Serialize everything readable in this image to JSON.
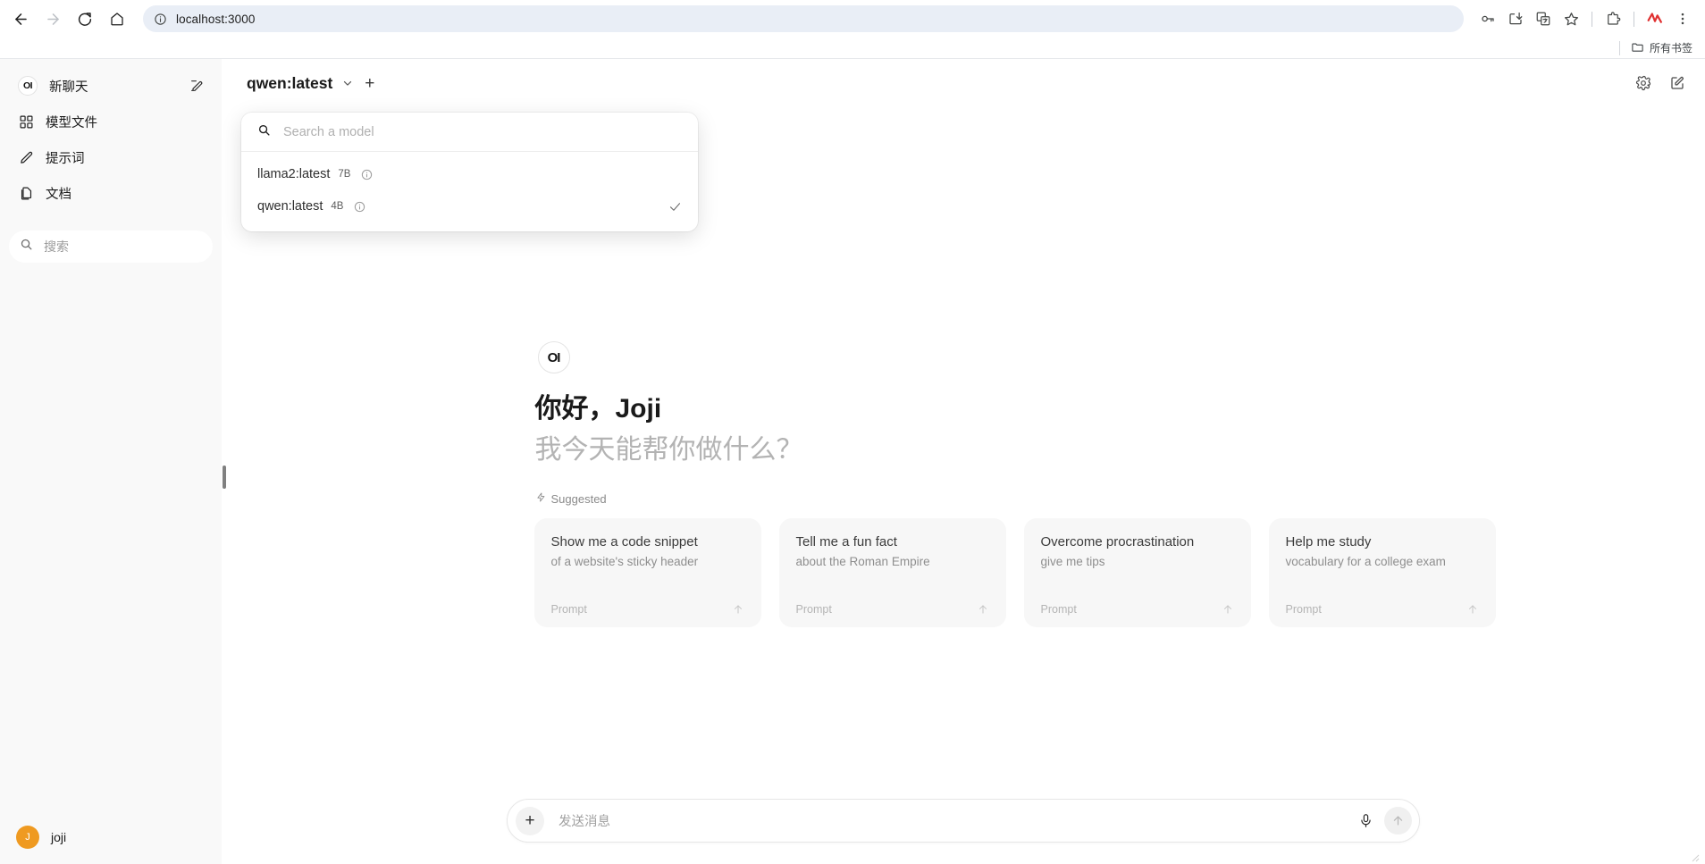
{
  "browser": {
    "url": "localhost:3000",
    "nav": {
      "back": "back-arrow",
      "forward": "forward-arrow",
      "reload": "reload",
      "home": "home"
    },
    "toolbar_icons": [
      "password-key-icon",
      "install-app-icon",
      "translate-icon",
      "bookmark-star-icon",
      "extensions-icon",
      "profile-logo-icon",
      "chrome-menu-icon"
    ],
    "bookmarks": {
      "all_bookmarks_label": "所有书签"
    }
  },
  "sidebar": {
    "items": [
      {
        "label": "新聊天",
        "icon": "openwebui-logo",
        "trailing_icon": "new-chat-edit-icon"
      },
      {
        "label": "模型文件",
        "icon": "modelfiles-icon"
      },
      {
        "label": "提示词",
        "icon": "pencil-icon"
      },
      {
        "label": "文档",
        "icon": "documents-icon"
      }
    ],
    "search": {
      "placeholder": "搜索",
      "icon": "search-icon"
    },
    "user": {
      "name": "joji",
      "initial": "J",
      "avatar_color": "#ef9a21"
    }
  },
  "header": {
    "selected_model": "qwen:latest",
    "chevron_icon": "chevron-down-icon",
    "add_model_label": "+",
    "settings_icon": "gear-icon",
    "new_chat_icon": "new-chat-edit-icon"
  },
  "model_dropdown": {
    "search_placeholder": "Search a model",
    "search_icon": "search-icon",
    "items": [
      {
        "name": "llama2:latest",
        "size": "7B",
        "selected": false
      },
      {
        "name": "qwen:latest",
        "size": "4B",
        "selected": true
      }
    ]
  },
  "welcome": {
    "avatar_text": "OI",
    "greeting": "你好，Joji",
    "subtitle": "我今天能帮你做什么？",
    "suggested_label": "Suggested",
    "suggested_icon": "lightning-icon"
  },
  "cards": [
    {
      "title": "Show me a code snippet",
      "subtitle": "of a website's sticky header",
      "footer": "Prompt",
      "arrow_icon": "arrow-up-icon"
    },
    {
      "title": "Tell me a fun fact",
      "subtitle": "about the Roman Empire",
      "footer": "Prompt",
      "arrow_icon": "arrow-up-icon"
    },
    {
      "title": "Overcome procrastination",
      "subtitle": "give me tips",
      "footer": "Prompt",
      "arrow_icon": "arrow-up-icon"
    },
    {
      "title": "Help me study",
      "subtitle": "vocabulary for a college exam",
      "footer": "Prompt",
      "arrow_icon": "arrow-up-icon"
    }
  ],
  "composer": {
    "placeholder": "发送消息",
    "plus_label": "+",
    "mic_icon": "microphone-icon",
    "send_icon": "arrow-up-icon"
  },
  "colors": {
    "sidebar_bg": "#f9f9f9",
    "card_bg": "#f7f7f7",
    "accent_orange": "#ef9a21",
    "omnibox_bg": "#e9eef6"
  }
}
